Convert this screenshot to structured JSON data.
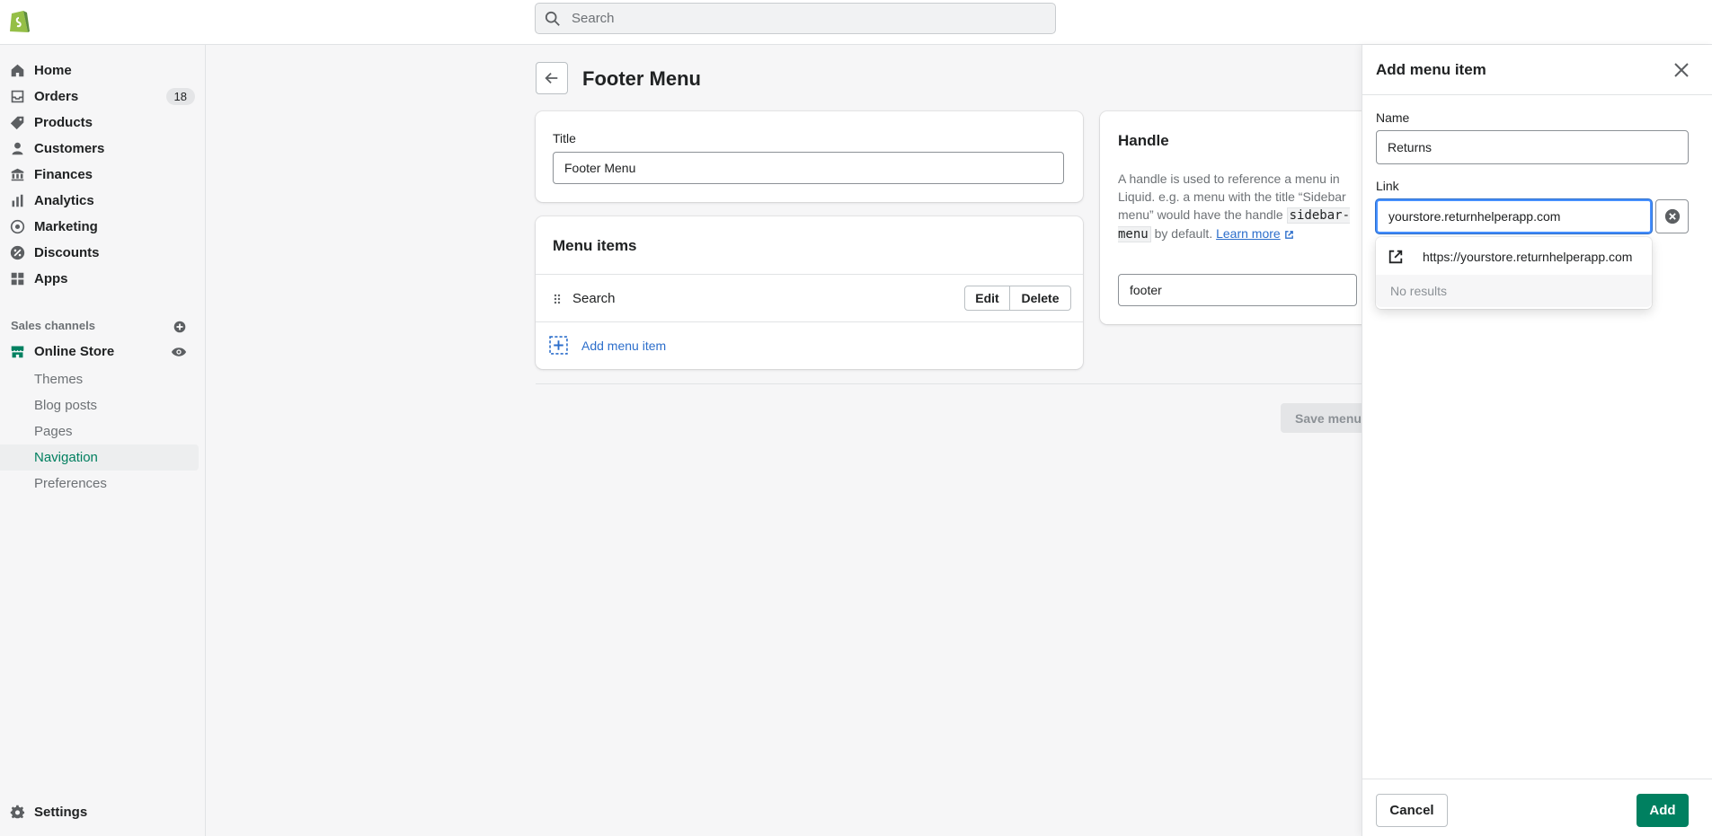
{
  "search": {
    "placeholder": "Search"
  },
  "sidebar": {
    "items": [
      {
        "label": "Home"
      },
      {
        "label": "Orders",
        "badge": "18"
      },
      {
        "label": "Products"
      },
      {
        "label": "Customers"
      },
      {
        "label": "Finances"
      },
      {
        "label": "Analytics"
      },
      {
        "label": "Marketing"
      },
      {
        "label": "Discounts"
      },
      {
        "label": "Apps"
      }
    ],
    "sales_channels_label": "Sales channels",
    "online_store": "Online Store",
    "sub_items": [
      {
        "label": "Themes"
      },
      {
        "label": "Blog posts"
      },
      {
        "label": "Pages"
      },
      {
        "label": "Navigation"
      },
      {
        "label": "Preferences"
      }
    ],
    "settings": "Settings"
  },
  "page": {
    "title": "Footer Menu",
    "title_field_label": "Title",
    "title_field_value": "Footer Menu",
    "menu_items_heading": "Menu items",
    "menu_items": [
      {
        "label": "Search"
      }
    ],
    "edit_label": "Edit",
    "delete_label": "Delete",
    "add_menu_item": "Add menu item",
    "handle_heading": "Handle",
    "handle_desc_1": "A handle is used to reference a menu in Liquid. e.g. a menu with the title “Sidebar menu” would have the handle",
    "handle_code": "sidebar-menu",
    "handle_desc_2": "by default.",
    "learn_more": "Learn more",
    "handle_value": "footer",
    "save_menu": "Save menu"
  },
  "drawer": {
    "title": "Add menu item",
    "name_label": "Name",
    "name_value": "Returns",
    "link_label": "Link",
    "link_value": "yourstore.returnhelperapp.com",
    "suggestion": "https://yourstore.returnhelperapp.com",
    "no_results": "No results",
    "cancel": "Cancel",
    "add": "Add"
  },
  "colors": {
    "accent": "#008060",
    "active_nav": "#007f5f",
    "link": "#2c6ecb"
  }
}
